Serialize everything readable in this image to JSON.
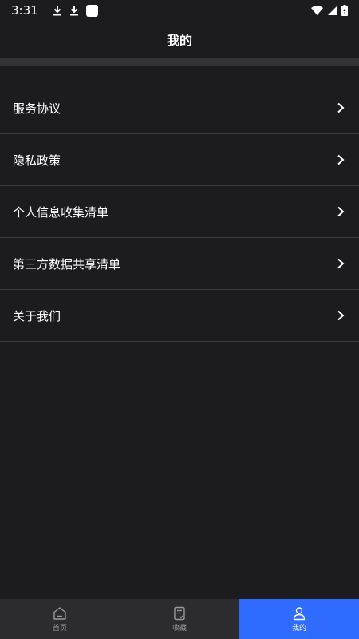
{
  "status_bar": {
    "time": "3:31",
    "left_icons": [
      "download-icon",
      "download-icon",
      "app-square-icon"
    ],
    "right_icons": [
      "wifi-icon",
      "signal-icon",
      "battery-charging-icon"
    ]
  },
  "header": {
    "title": "我的"
  },
  "menu": {
    "items": [
      {
        "label": "服务协议",
        "icon": "chevron-right-icon"
      },
      {
        "label": "隐私政策",
        "icon": "chevron-right-icon"
      },
      {
        "label": "个人信息收集清单",
        "icon": "chevron-right-icon"
      },
      {
        "label": "第三方数据共享清单",
        "icon": "chevron-right-icon"
      },
      {
        "label": "关于我们",
        "icon": "chevron-right-icon"
      }
    ]
  },
  "bottom_nav": {
    "tabs": [
      {
        "label": "首页",
        "icon": "home-icon",
        "active": false
      },
      {
        "label": "收藏",
        "icon": "favorites-document-icon",
        "active": false
      },
      {
        "label": "我的",
        "icon": "user-icon",
        "active": true
      }
    ]
  },
  "colors": {
    "background": "#1c1c1e",
    "divider": "#333335",
    "nav_background": "#2c2c2e",
    "accent": "#2f6bff",
    "text": "#ffffff",
    "inactive_text": "#9a9a9e"
  }
}
